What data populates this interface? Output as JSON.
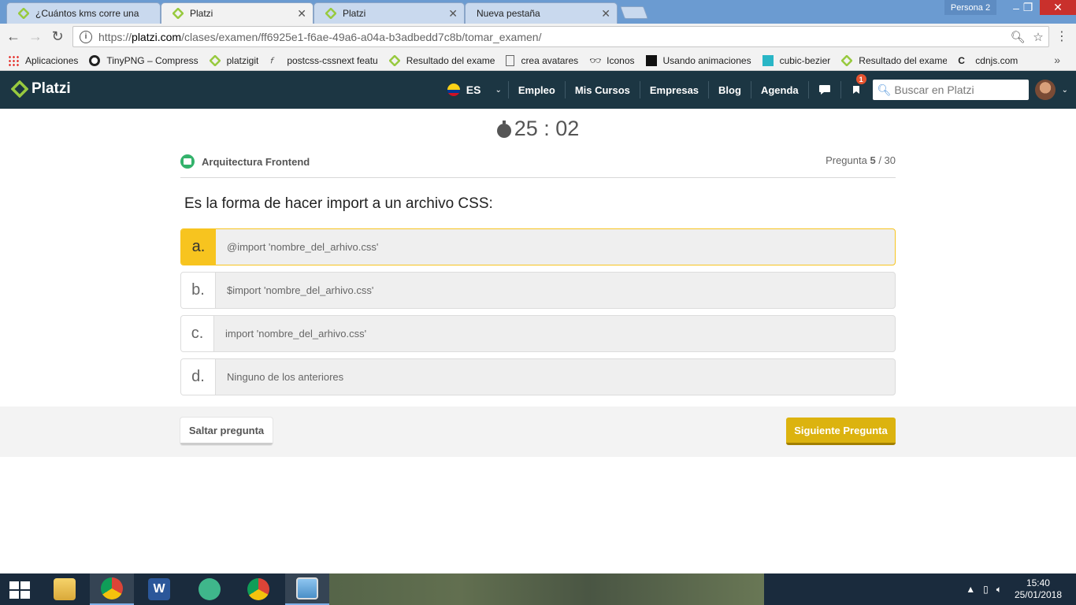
{
  "browser": {
    "tabs": [
      {
        "title": "¿Cuántos kms corre una",
        "active": false
      },
      {
        "title": "Platzi",
        "active": true
      },
      {
        "title": "Platzi",
        "active": false
      },
      {
        "title": "Nueva pestaña",
        "active": false
      }
    ],
    "profile": "Persona 2",
    "url_prefix": "https://",
    "url_domain": "platzi.com",
    "url_path": "/clases/examen/ff6925e1-f6ae-49a6-a04a-b3adbedd7c8b/tomar_examen/",
    "bookmarks": [
      {
        "label": "Aplicaciones",
        "icon": "apps-grid-icon"
      },
      {
        "label": "TinyPNG – Compress",
        "icon": "panda-icon"
      },
      {
        "label": "platzigit",
        "icon": "platzi-icon"
      },
      {
        "label": "postcss-cssnext featu",
        "icon": "postcss-icon"
      },
      {
        "label": "Resultado del exame",
        "icon": "platzi-icon"
      },
      {
        "label": "crea avatares",
        "icon": "page-icon"
      },
      {
        "label": "Iconos",
        "icon": "binoculars-icon"
      },
      {
        "label": "Usando animaciones",
        "icon": "mdn-icon"
      },
      {
        "label": "cubic-bezier",
        "icon": "curve-icon"
      },
      {
        "label": "Resultado del exame",
        "icon": "platzi-icon"
      },
      {
        "label": "cdnjs.com",
        "icon": "cdnjs-icon"
      }
    ],
    "bookmarks_more": "»"
  },
  "header": {
    "logo": "Platzi",
    "lang": "ES",
    "nav": [
      "Empleo",
      "Mis Cursos",
      "Empresas",
      "Blog",
      "Agenda"
    ],
    "notifications_count": "1",
    "search_placeholder": "Buscar en Platzi"
  },
  "exam": {
    "timer": "25 : 02",
    "course": "Arquitectura Frontend",
    "question_label": "Pregunta",
    "question_current": "5",
    "question_total": "/ 30",
    "question": "Es la forma de hacer import a un archivo CSS:",
    "answers": [
      {
        "letter": "a.",
        "text": "@import 'nombre_del_arhivo.css'",
        "selected": true
      },
      {
        "letter": "b.",
        "text": "$import 'nombre_del_arhivo.css'",
        "selected": false
      },
      {
        "letter": "c.",
        "text": "import 'nombre_del_arhivo.css'",
        "selected": false
      },
      {
        "letter": "d.",
        "text": "Ninguno de los anteriores",
        "selected": false
      }
    ],
    "skip_label": "Saltar pregunta",
    "next_label": "Siguiente Pregunta"
  },
  "taskbar": {
    "time": "15:40",
    "date": "25/01/2018"
  },
  "colors": {
    "platzi_dark": "#1c3643",
    "platzi_green": "#98ca3f",
    "selected_yellow": "#f7c41f",
    "next_button": "#dcb30f"
  }
}
